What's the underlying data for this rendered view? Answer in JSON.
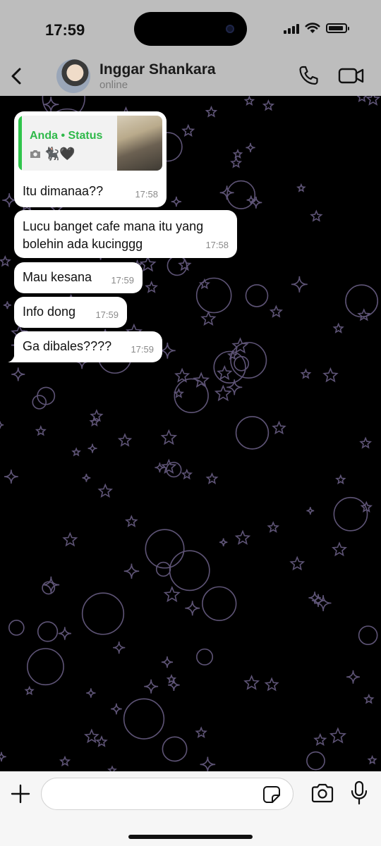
{
  "status_bar": {
    "time": "17:59"
  },
  "header": {
    "contact_name": "Inggar Shankara",
    "contact_status": "online",
    "back_icon": "chevron-left-icon",
    "call_icon": "phone-icon",
    "video_icon": "video-camera-icon"
  },
  "quoted_status": {
    "author": "Anda • Status",
    "icons": [
      "camera-icon",
      "black-cat-emoji",
      "black-heart-emoji"
    ],
    "emoji": "🐈‍⬛🖤"
  },
  "messages": [
    {
      "text": "Itu dimanaa??",
      "time": "17:58"
    },
    {
      "text": "Lucu banget cafe mana itu yang bolehin ada kucinggg",
      "time": "17:58"
    },
    {
      "text": "Mau kesana",
      "time": "17:59"
    },
    {
      "text": "Info dong",
      "time": "17:59"
    },
    {
      "text": "Ga dibales????",
      "time": "17:59"
    }
  ],
  "input": {
    "placeholder": ""
  },
  "colors": {
    "chrome": "#bdbdbd",
    "chat_background": "#000000",
    "bubble": "#ffffff",
    "quote_accent": "#30c54c",
    "doodle": "#5e5476"
  }
}
